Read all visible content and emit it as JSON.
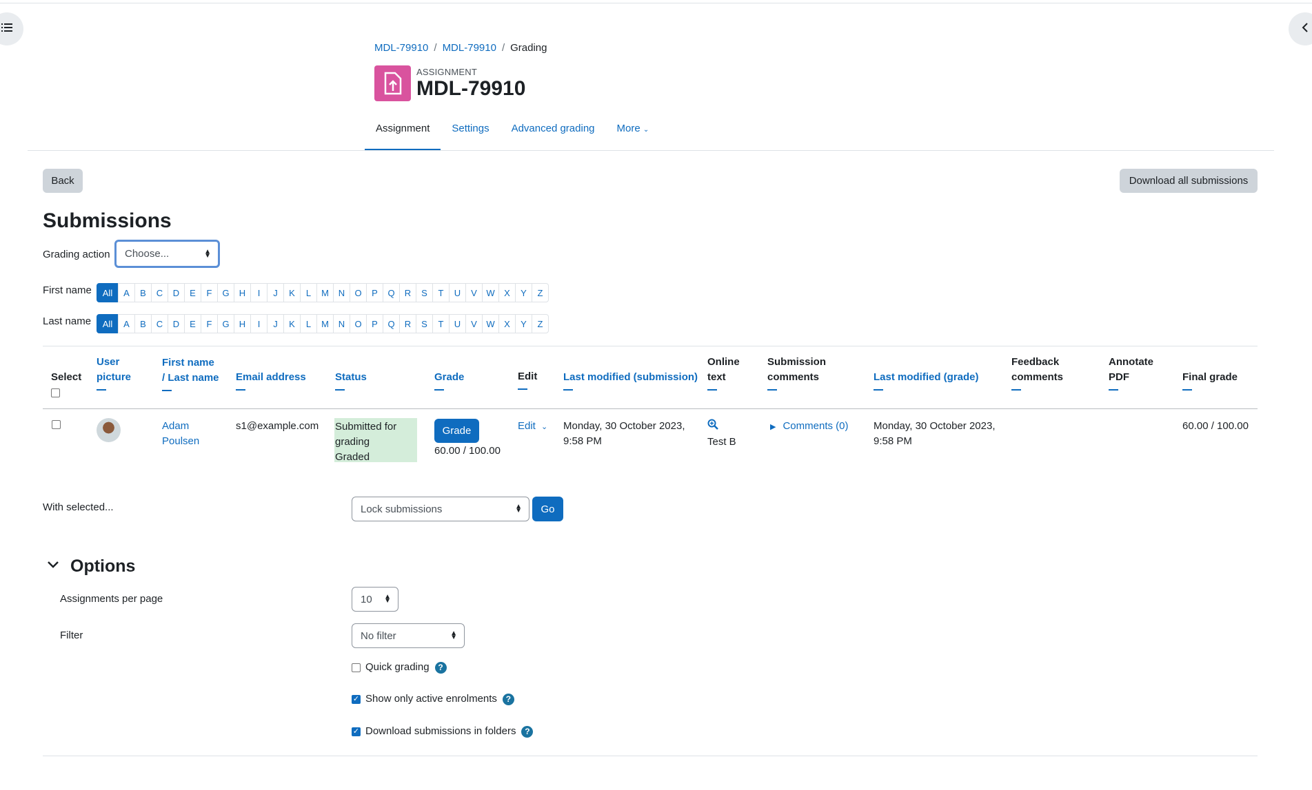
{
  "breadcrumb": [
    "MDL-79910",
    "MDL-79910",
    "Grading"
  ],
  "header": {
    "pretitle": "ASSIGNMENT",
    "title": "MDL-79910"
  },
  "tabs": {
    "assignment": "Assignment",
    "settings": "Settings",
    "advanced_grading": "Advanced grading",
    "more": "More"
  },
  "actions": {
    "back": "Back",
    "download_all": "Download all submissions"
  },
  "submissions": {
    "heading": "Submissions",
    "grading_action_label": "Grading action",
    "grading_action_value": "Choose...",
    "first_name_label": "First name",
    "last_name_label": "Last name",
    "letters": [
      "All",
      "A",
      "B",
      "C",
      "D",
      "E",
      "F",
      "G",
      "H",
      "I",
      "J",
      "K",
      "L",
      "M",
      "N",
      "O",
      "P",
      "Q",
      "R",
      "S",
      "T",
      "U",
      "V",
      "W",
      "X",
      "Y",
      "Z"
    ]
  },
  "table": {
    "headers": {
      "select": "Select",
      "user_picture": [
        "User",
        "picture"
      ],
      "first_name": "First name",
      "last_name": "/ Last name",
      "email": "Email address",
      "status": "Status",
      "grade": "Grade",
      "edit": "Edit",
      "last_modified_submission": "Last modified (submission)",
      "online_text": [
        "Online",
        "text"
      ],
      "submission_comments": [
        "Submission",
        "comments"
      ],
      "last_modified_grade": "Last modified (grade)",
      "feedback_comments": [
        "Feedback",
        "comments"
      ],
      "annotate_pdf": [
        "Annotate",
        "PDF"
      ],
      "final_grade": "Final grade"
    },
    "row": {
      "first_name": "Adam",
      "last_name": "Poulsen",
      "email": "s1@example.com",
      "status": [
        "Submitted for",
        "grading",
        "Graded"
      ],
      "grade_button": "Grade",
      "grade_value": "60.00 / 100.00",
      "edit": "Edit",
      "last_modified_submission": [
        "Monday, 30 October 2023,",
        "9:58 PM"
      ],
      "online_text": "Test B",
      "comments": "Comments (0)",
      "last_modified_grade": [
        "Monday, 30 October 2023,",
        "9:58 PM"
      ],
      "final_grade": "60.00 / 100.00"
    }
  },
  "bulk": {
    "label": "With selected...",
    "select_value": "Lock submissions",
    "go": "Go"
  },
  "options": {
    "heading": "Options",
    "per_page_label": "Assignments per page",
    "per_page_value": "10",
    "filter_label": "Filter",
    "filter_value": "No filter",
    "quick_grading": "Quick grading",
    "quick_grading_checked": false,
    "show_active": "Show only active enrolments",
    "show_active_checked": true,
    "download_folders": "Download submissions in folders",
    "download_folders_checked": true
  }
}
